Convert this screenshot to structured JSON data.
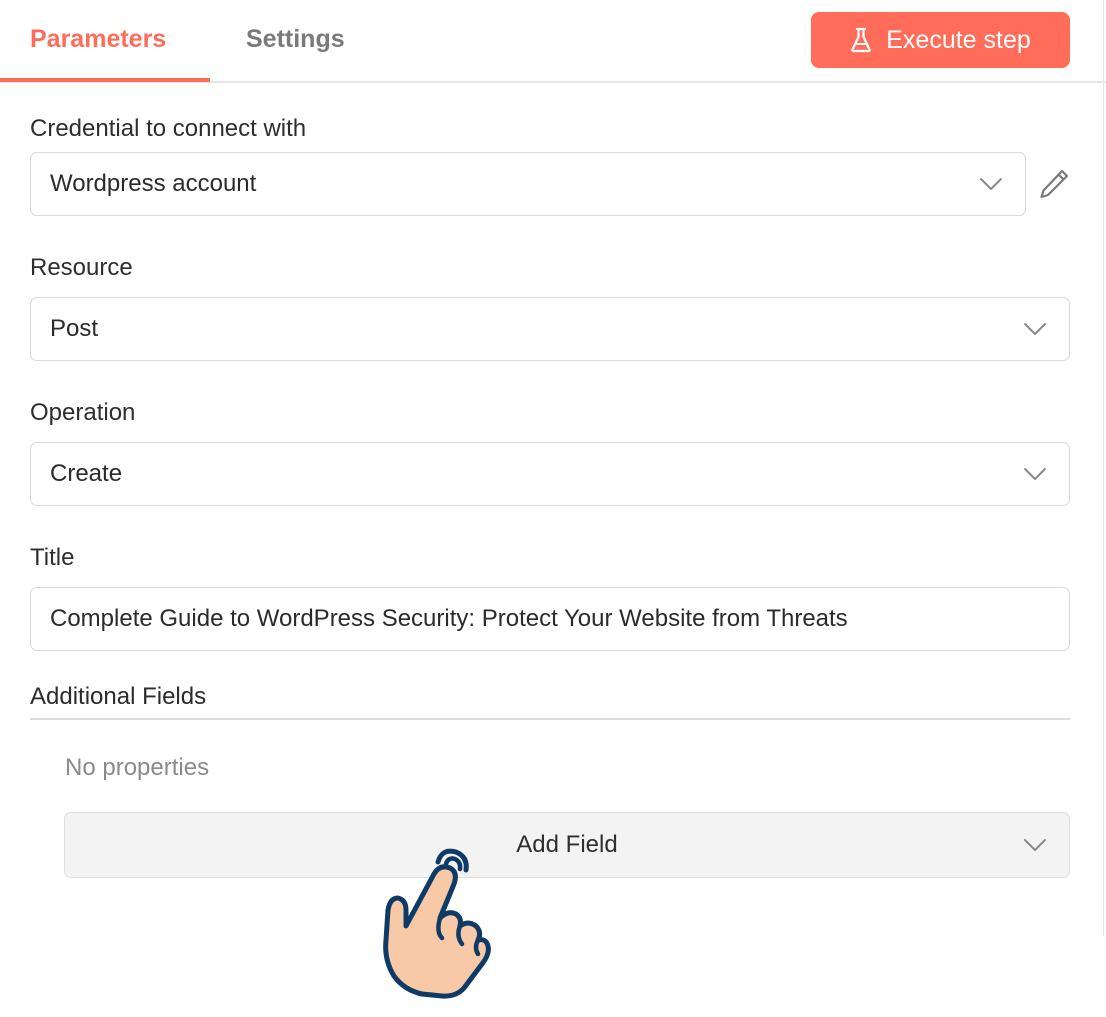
{
  "tabs": {
    "parameters_label": "Parameters",
    "settings_label": "Settings",
    "active": "Parameters"
  },
  "toolbar": {
    "execute_label": "Execute step",
    "execute_icon": "flask-icon"
  },
  "fields": {
    "credential": {
      "label": "Credential to connect with",
      "value": "Wordpress account"
    },
    "resource": {
      "label": "Resource",
      "value": "Post"
    },
    "operation": {
      "label": "Operation",
      "value": "Create"
    },
    "title": {
      "label": "Title",
      "value": "Complete Guide to WordPress Security: Protect Your Website from Threats"
    }
  },
  "additional_fields": {
    "title": "Additional Fields",
    "empty_text": "No properties",
    "add_label": "Add Field"
  },
  "colors": {
    "accent": "#ff6d5a",
    "text": "#2b2b2b",
    "muted": "#8a8a8a",
    "border": "#d9d9d9"
  },
  "icons": [
    "flask-icon",
    "chevron-down-icon",
    "pencil-icon",
    "pointer-hand-icon"
  ]
}
